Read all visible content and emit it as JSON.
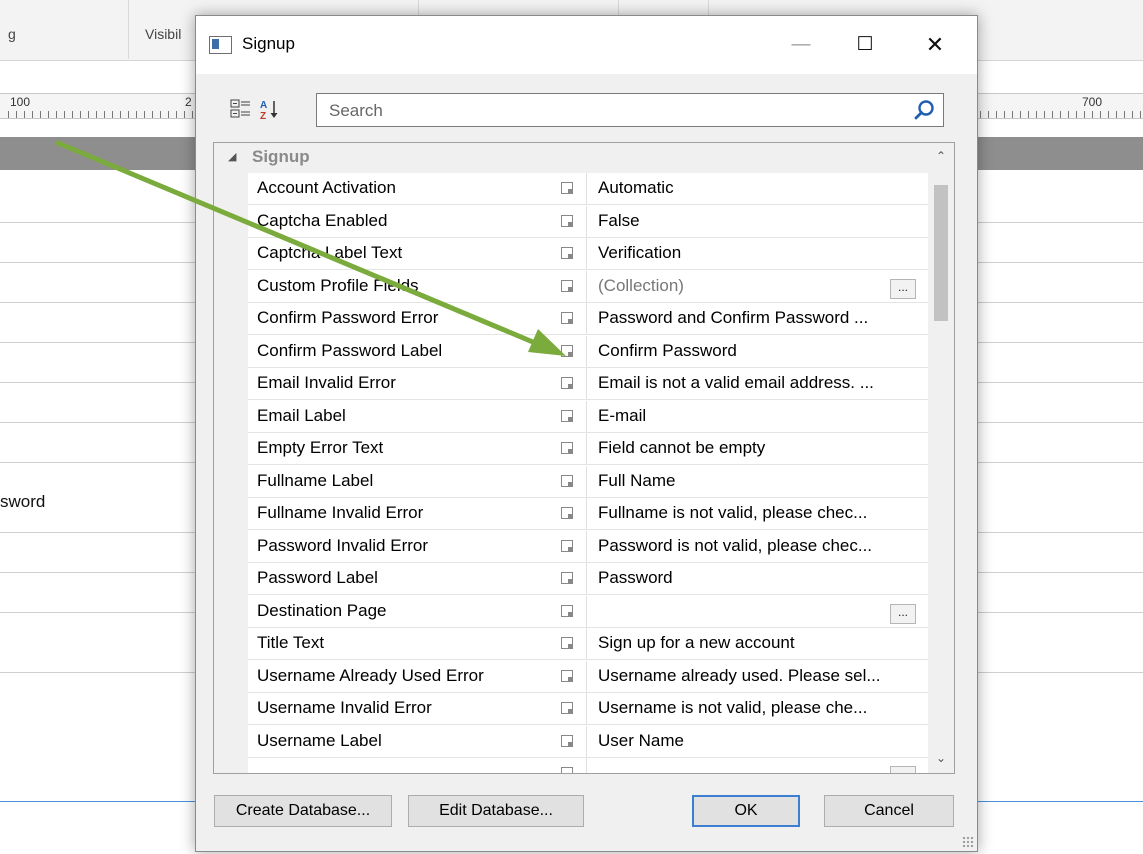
{
  "background": {
    "toolbar_labels": [
      "g",
      "Visibil"
    ],
    "ruler_numbers": [
      "100",
      "2",
      "700"
    ],
    "partial_text": "sword"
  },
  "dialog": {
    "title": "Signup",
    "window_controls": {
      "minimize": "—",
      "maximize": "☐",
      "close": "✕"
    },
    "toolbar": {
      "categorized_icon": "categorized-view-icon",
      "alpha_icon": "sort-alpha-icon"
    },
    "search": {
      "placeholder": "Search",
      "value": ""
    },
    "category": "Signup",
    "properties": [
      {
        "name": "Account Activation",
        "value": "Automatic",
        "has_button": false
      },
      {
        "name": "Captcha Enabled",
        "value": "False",
        "has_button": false
      },
      {
        "name": "Captcha Label Text",
        "value": "Verification",
        "has_button": false
      },
      {
        "name": "Custom Profile Fields",
        "value": "(Collection)",
        "has_button": true
      },
      {
        "name": "Confirm Password Error",
        "value": "Password and Confirm Password ...",
        "has_button": false
      },
      {
        "name": "Confirm Password Label",
        "value": "Confirm Password",
        "has_button": false
      },
      {
        "name": "Email Invalid Error",
        "value": "Email is not a valid email address. ...",
        "has_button": false
      },
      {
        "name": "Email Label",
        "value": "E-mail",
        "has_button": false
      },
      {
        "name": "Empty Error Text",
        "value": "Field cannot be empty",
        "has_button": false
      },
      {
        "name": "Fullname Label",
        "value": "Full Name",
        "has_button": false
      },
      {
        "name": "Fullname Invalid Error",
        "value": "Fullname is not valid, please chec...",
        "has_button": false
      },
      {
        "name": "Password Invalid Error",
        "value": "Password is not valid, please chec...",
        "has_button": false
      },
      {
        "name": "Password Label",
        "value": "Password",
        "has_button": false
      },
      {
        "name": "Destination Page",
        "value": "",
        "has_button": true
      },
      {
        "name": "Title Text",
        "value": "Sign up for a new account",
        "has_button": false
      },
      {
        "name": "Username Already Used Error",
        "value": "Username already used. Please sel...",
        "has_button": false
      },
      {
        "name": "Username Invalid Error",
        "value": "Username is not valid, please che...",
        "has_button": false
      },
      {
        "name": "Username Label",
        "value": "User Name",
        "has_button": false
      },
      {
        "name": "",
        "value": "",
        "has_button": true
      }
    ],
    "ellipsis_label": "...",
    "buttons": {
      "create_db": "Create Database...",
      "edit_db": "Edit Database...",
      "ok": "OK",
      "cancel": "Cancel"
    }
  },
  "colors": {
    "annotation_arrow": "#7aab3c",
    "ok_border": "#3c7fd1",
    "band": "#8e8e8e"
  }
}
